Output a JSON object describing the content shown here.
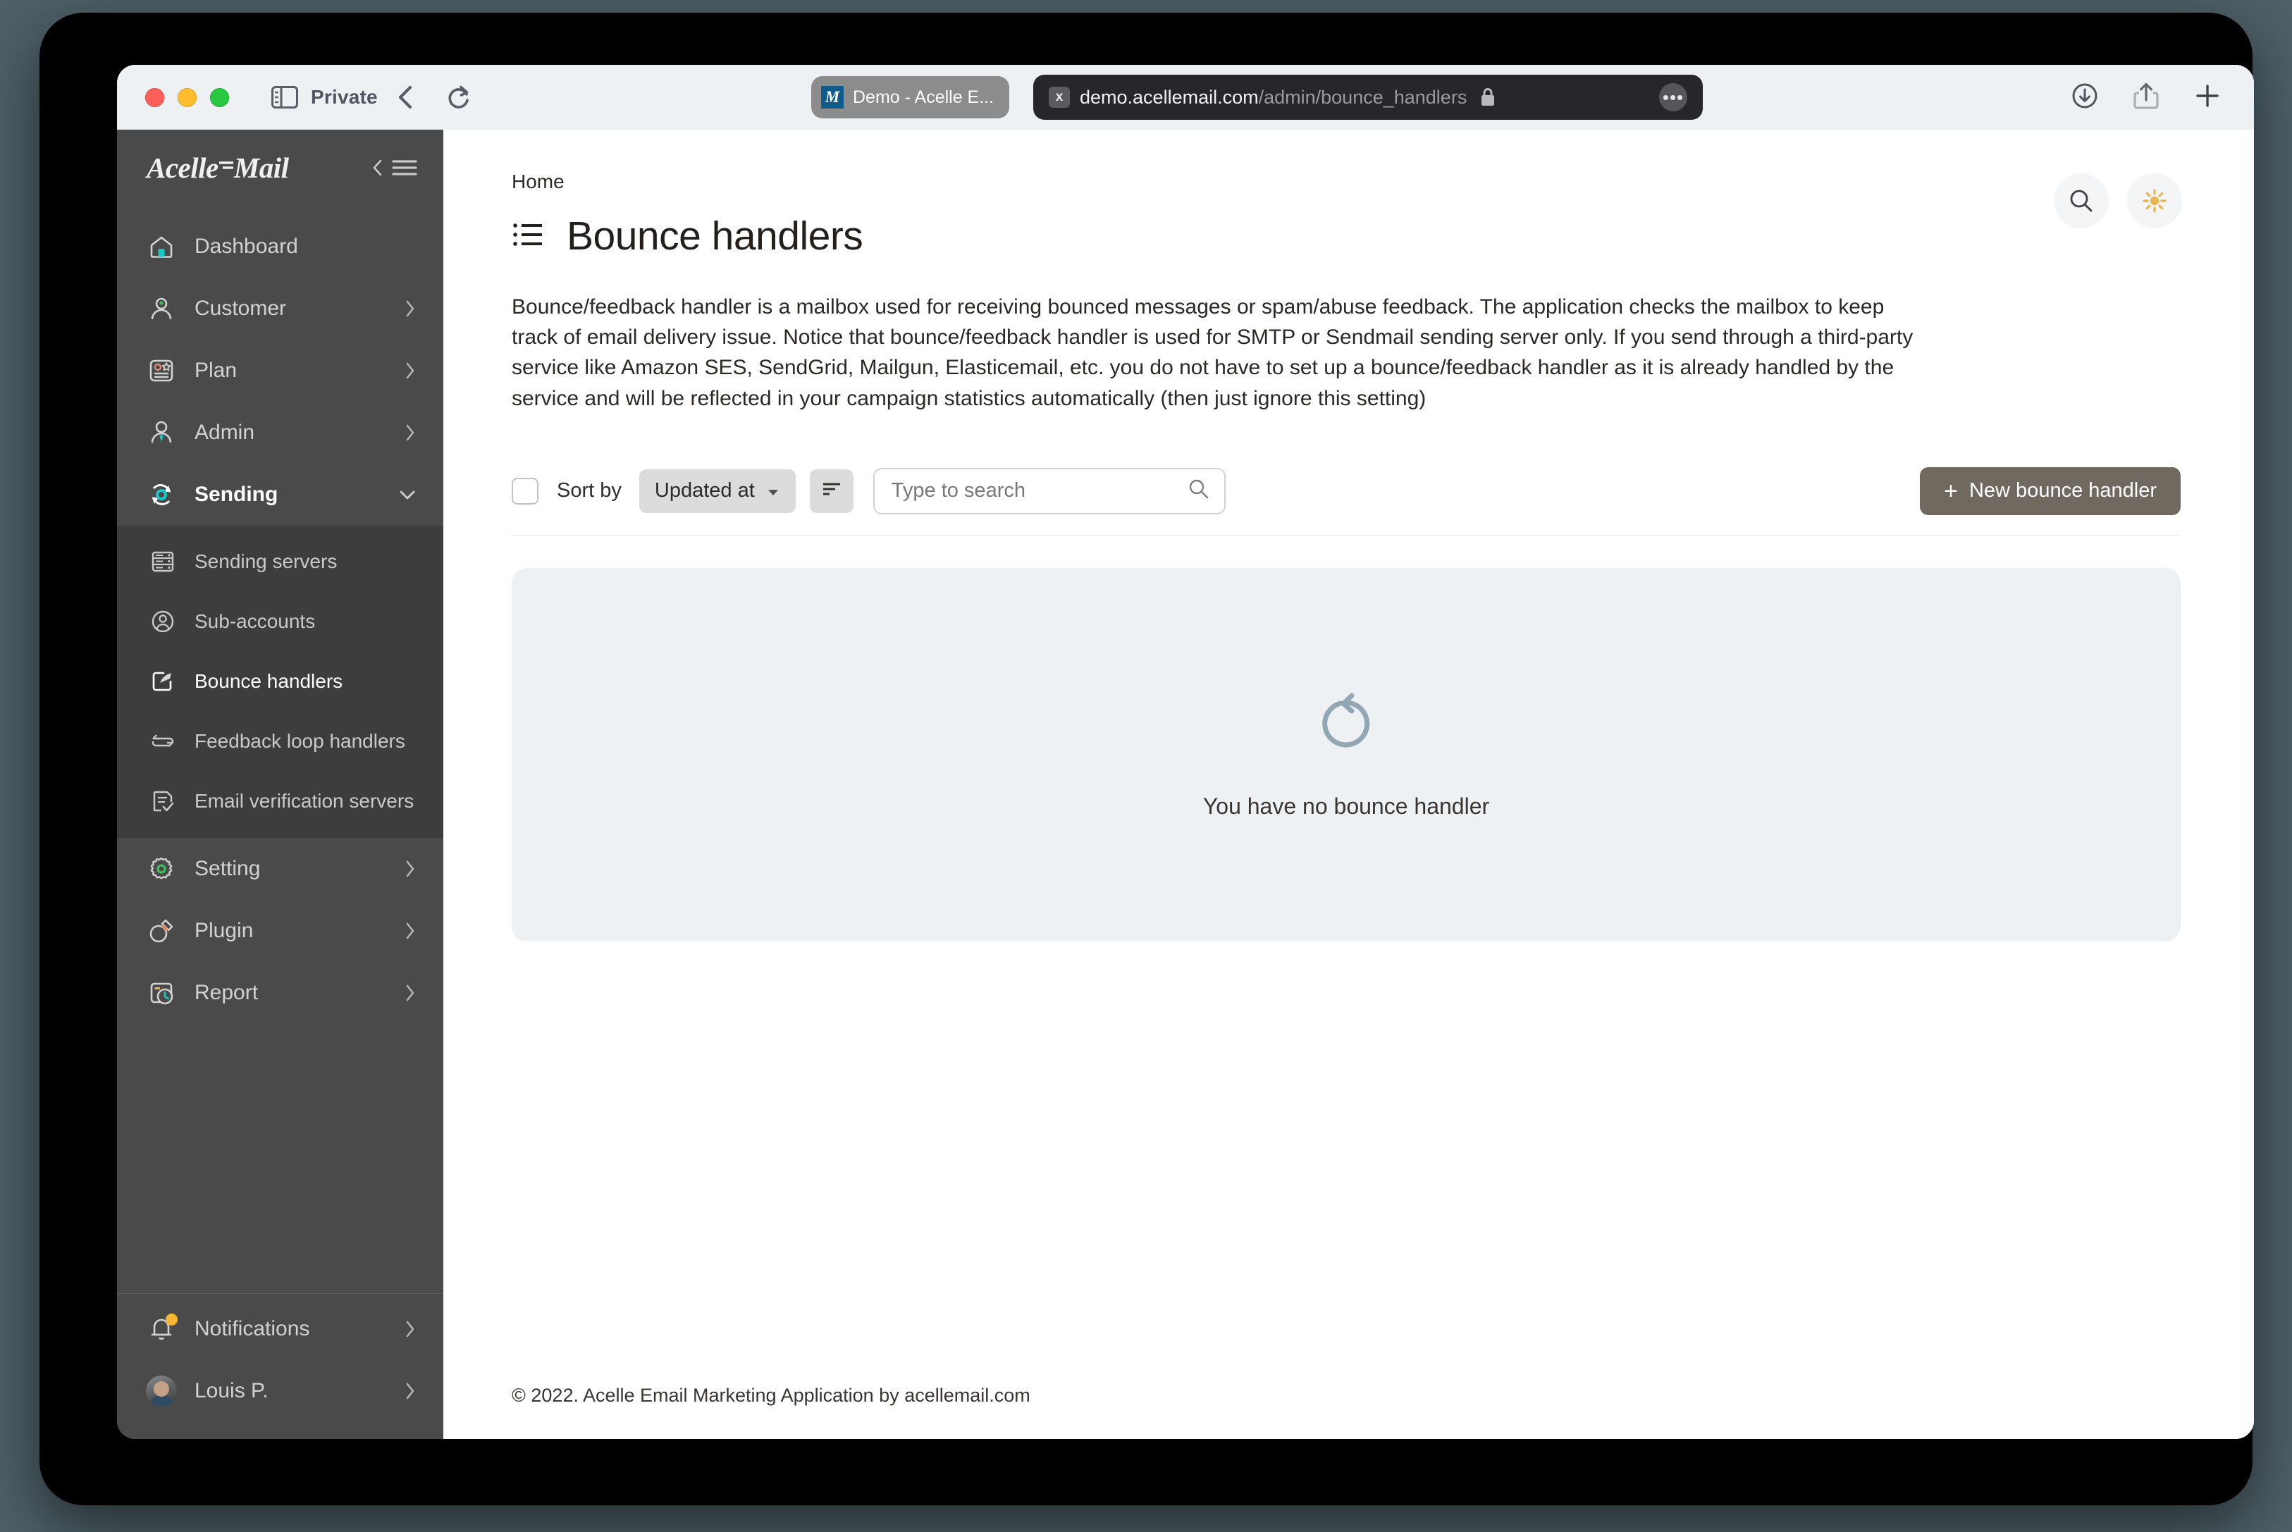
{
  "browser": {
    "private_label": "Private",
    "tab": {
      "favicon_letter": "M",
      "title": "Demo - Acelle E..."
    },
    "url": {
      "shield": "x",
      "host": "demo.acellemail.com",
      "path": "/admin/bounce_handlers"
    },
    "icons": {
      "sidebar_toggle": "sidebar-toggle-icon",
      "back": "back-chevron-icon",
      "reload": "reload-icon",
      "lock": "lock-icon",
      "more": "more-options-icon",
      "downloads": "downloads-icon",
      "share": "share-icon",
      "new_tab": "new-tab-icon"
    }
  },
  "sidebar": {
    "brand": {
      "part1": "Acelle",
      "part2": "Mail"
    },
    "collapse_label": "collapse-sidebar",
    "items": [
      {
        "label": "Dashboard",
        "icon": "home-icon",
        "chevron": "",
        "state": "normal"
      },
      {
        "label": "Customer",
        "icon": "user-icon",
        "chevron": "›",
        "state": "normal"
      },
      {
        "label": "Plan",
        "icon": "plan-card-icon",
        "chevron": "›",
        "state": "normal"
      },
      {
        "label": "Admin",
        "icon": "admin-user-icon",
        "chevron": "›",
        "state": "normal"
      },
      {
        "label": "Sending",
        "icon": "sending-sync-icon",
        "chevron": "⌄",
        "state": "expanded"
      }
    ],
    "submenu": [
      {
        "label": "Sending servers",
        "icon": "server-icon",
        "current": false
      },
      {
        "label": "Sub-accounts",
        "icon": "account-circle-icon",
        "current": false
      },
      {
        "label": "Bounce handlers",
        "icon": "external-link-icon",
        "current": true
      },
      {
        "label": "Feedback loop handlers",
        "icon": "loop-arrows-icon",
        "current": false
      },
      {
        "label": "Email verification servers",
        "icon": "verified-list-icon",
        "current": false
      }
    ],
    "items_after": [
      {
        "label": "Setting",
        "icon": "gear-icon",
        "chevron": "›"
      },
      {
        "label": "Plugin",
        "icon": "plug-icon",
        "chevron": "›"
      },
      {
        "label": "Report",
        "icon": "report-clock-icon",
        "chevron": "›"
      }
    ],
    "bottom": [
      {
        "label": "Notifications",
        "icon": "bell-icon",
        "chevron": "›",
        "badge": true
      },
      {
        "label": "Louis P.",
        "icon": "avatar",
        "chevron": "›",
        "badge": false
      }
    ]
  },
  "main": {
    "breadcrumb": "Home",
    "title": "Bounce handlers",
    "title_icon": "list-icon",
    "search_icon": "search-icon",
    "theme_icon": "sun-icon",
    "description": "Bounce/feedback handler is a mailbox used for receiving bounced messages or spam/abuse feedback. The application checks the mailbox to keep track of email delivery issue. Notice that bounce/feedback handler is used for SMTP or Sendmail sending server only. If you send through a third-party service like Amazon SES, SendGrid, Mailgun, Elasticemail, etc. you do not have to set up a bounce/feedback handler as it is already handled by the service and will be reflected in your campaign statistics automatically (then just ignore this setting)",
    "toolbar": {
      "sort_by_label": "Sort by",
      "sort_value": "Updated at",
      "sort_dir_icon": "sort-descending-icon",
      "search_placeholder": "Type to search",
      "search_value": "",
      "search_icon": "search-icon",
      "new_button_label": "New bounce handler",
      "new_button_plus": "+"
    },
    "empty_state": {
      "icon": "refresh-circle-icon",
      "text": "You have no bounce handler"
    }
  },
  "footer": {
    "text": "© 2022. Acelle Email Marketing Application by ",
    "link": "acellemail.com"
  },
  "colors": {
    "sidebar_bg": "#4a4a4a",
    "submenu_bg": "#3d3d3d",
    "accent_button": "#6f6960",
    "empty_panel": "#eef1f4",
    "sun": "#e8b44f",
    "badge": "#f5b731"
  }
}
